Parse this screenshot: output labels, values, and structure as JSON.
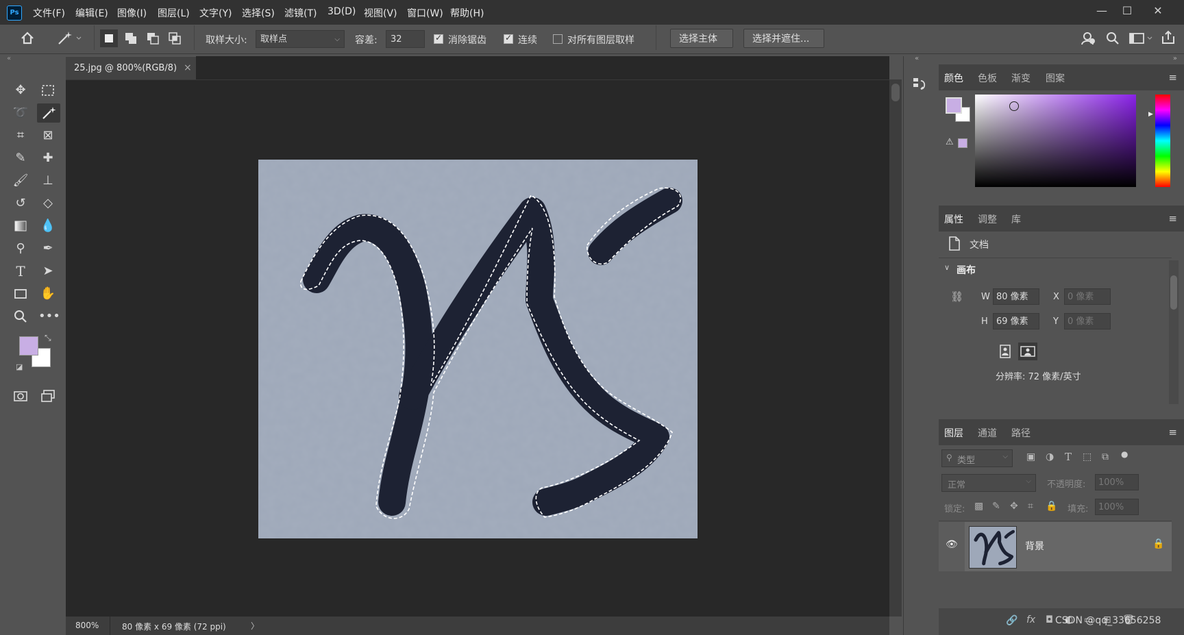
{
  "app": {
    "logo": "Ps"
  },
  "menu": [
    "文件(F)",
    "编辑(E)",
    "图像(I)",
    "图层(L)",
    "文字(Y)",
    "选择(S)",
    "滤镜(T)",
    "3D(D)",
    "视图(V)",
    "窗口(W)",
    "帮助(H)"
  ],
  "window_controls": {
    "minimize": "—",
    "maximize": "☐",
    "close": "✕"
  },
  "options": {
    "sample_size_label": "取样大小:",
    "sample_size_value": "取样点",
    "tolerance_label": "容差:",
    "tolerance_value": "32",
    "antialias_label": "消除锯齿",
    "antialias_checked": true,
    "contiguous_label": "连续",
    "contiguous_checked": true,
    "sample_all_layers_label": "对所有图层取样",
    "sample_all_layers_checked": false,
    "select_subject_label": "选择主体",
    "select_and_mask_label": "选择并遮住..."
  },
  "colors": {
    "foreground": "#c8aee4",
    "background": "#ffffff",
    "accent": "#31a8ff"
  },
  "document": {
    "tab_title": "25.jpg @ 800%(RGB/8)",
    "tab_close": "×",
    "zoom": "800%",
    "size_info": "80 像素 x 69 像素 (72 ppi)",
    "status_arrow": "〉"
  },
  "color_panel": {
    "tabs": [
      "颜色",
      "色板",
      "渐变",
      "图案"
    ],
    "active": 0
  },
  "properties_panel": {
    "tabs": [
      "属性",
      "调整",
      "库"
    ],
    "doc_label": "文档",
    "section": "画布",
    "w_label": "W",
    "w_value": "80 像素",
    "h_label": "H",
    "h_value": "69 像素",
    "x_label": "X",
    "x_value": "0 像素",
    "y_label": "Y",
    "y_value": "0 像素",
    "resolution": "分辨率: 72 像素/英寸"
  },
  "layers_panel": {
    "tabs": [
      "图层",
      "通道",
      "路径"
    ],
    "filter_placeholder": "类型",
    "blend_mode": "正常",
    "opacity_label": "不透明度:",
    "opacity_value": "100%",
    "lock_label": "锁定:",
    "fill_label": "填充:",
    "fill_value": "100%",
    "layer_name": "背景"
  },
  "watermark": "CSDN @qq_33656258"
}
